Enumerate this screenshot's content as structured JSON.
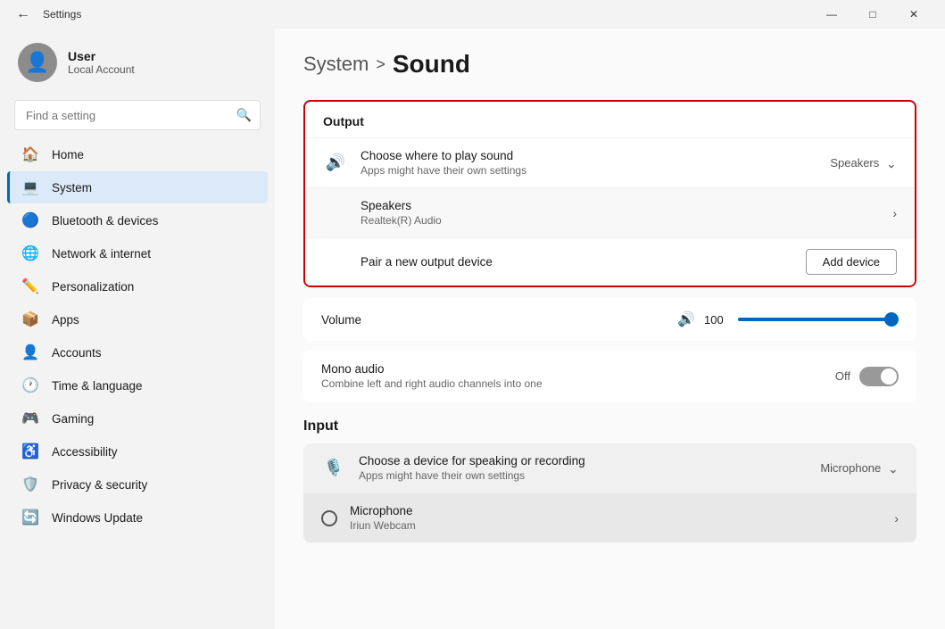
{
  "titlebar": {
    "title": "Settings",
    "back_label": "←",
    "minimize": "—",
    "maximize": "□",
    "close": "✕"
  },
  "user": {
    "name": "User",
    "account": "Local Account"
  },
  "search": {
    "placeholder": "Find a setting"
  },
  "nav": {
    "items": [
      {
        "id": "home",
        "label": "Home",
        "icon": "🏠"
      },
      {
        "id": "system",
        "label": "System",
        "icon": "💻",
        "active": true
      },
      {
        "id": "bluetooth",
        "label": "Bluetooth & devices",
        "icon": "🔵"
      },
      {
        "id": "network",
        "label": "Network & internet",
        "icon": "🌐"
      },
      {
        "id": "personalization",
        "label": "Personalization",
        "icon": "✏️"
      },
      {
        "id": "apps",
        "label": "Apps",
        "icon": "📦"
      },
      {
        "id": "accounts",
        "label": "Accounts",
        "icon": "👤"
      },
      {
        "id": "time",
        "label": "Time & language",
        "icon": "🕐"
      },
      {
        "id": "gaming",
        "label": "Gaming",
        "icon": "🎮"
      },
      {
        "id": "accessibility",
        "label": "Accessibility",
        "icon": "♿"
      },
      {
        "id": "privacy",
        "label": "Privacy & security",
        "icon": "🛡️"
      },
      {
        "id": "update",
        "label": "Windows Update",
        "icon": "🔄"
      }
    ]
  },
  "breadcrumb": {
    "parent": "System",
    "separator": ">",
    "current": "Sound"
  },
  "output": {
    "section_title": "Output",
    "choose_title": "Choose where to play sound",
    "choose_sub": "Apps might have their own settings",
    "choose_value": "Speakers",
    "speakers_title": "Speakers",
    "speakers_sub": "Realtek(R) Audio",
    "pair_label": "Pair a new output device",
    "add_btn": "Add device"
  },
  "volume": {
    "label": "Volume",
    "value": "100",
    "slider_pct": 100
  },
  "mono": {
    "label": "Mono audio",
    "sub": "Combine left and right audio channels into one",
    "state": "Off"
  },
  "input": {
    "section_title": "Input",
    "choose_title": "Choose a device for speaking or recording",
    "choose_sub": "Apps might have their own settings",
    "choose_value": "Microphone",
    "mic_title": "Microphone",
    "mic_sub": "Iriun Webcam"
  }
}
